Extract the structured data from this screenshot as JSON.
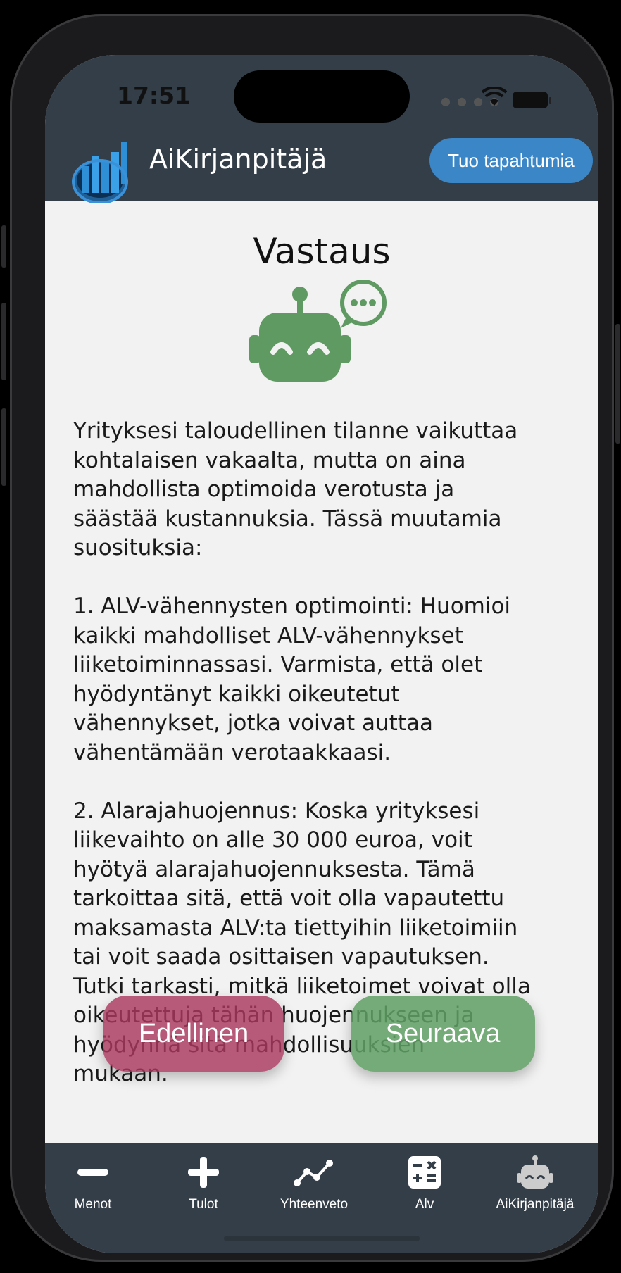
{
  "status_bar": {
    "time": "17:51"
  },
  "header": {
    "app_title": "AiKirjanpitäjä",
    "import_button": "Tuo tapahtumia"
  },
  "main": {
    "heading": "Vastaus",
    "answer_text": "Yrityksesi taloudellinen tilanne vaikuttaa\nkohtalaisen vakaalta, mutta on aina\nmahdollista optimoida verotusta ja\nsäästää kustannuksia. Tässä muutamia\nsuosituksia:\n\n1. ALV-vähennysten optimointi: Huomioi\nkaikki mahdolliset ALV-vähennykset\nliiketoiminnassasi. Varmista, että olet\nhyödyntänyt kaikki oikeutetut\nvähennykset, jotka voivat auttaa\nvähentämään verotaakkaasi.\n\n2. Alarajahuojennus: Koska yrityksesi\nliikevaihto on alle 30 000 euroa, voit\nhyötyä alarajahuojennuksesta. Tämä\ntarkoittaa sitä, että voit olla vapautettu\nmaksamasta ALV:ta tiettyihin liiketoimiin\ntai voit saada osittaisen vapautuksen.\nTutki tarkasti, mitkä liiketoimet voivat olla\noikeutettuja tähän huojennukseen ja\nhyödynnä sitä mahdollisuuksien\nmukaan.",
    "prev_button": "Edellinen",
    "next_button": "Seuraava"
  },
  "tabs": [
    {
      "label": "Menot",
      "icon": "minus-icon"
    },
    {
      "label": "Tulot",
      "icon": "plus-icon"
    },
    {
      "label": "Yhteenveto",
      "icon": "line-chart-icon"
    },
    {
      "label": "Alv",
      "icon": "calculator-icon"
    },
    {
      "label": "AiKirjanpitäjä",
      "icon": "robot-icon"
    }
  ],
  "colors": {
    "header_bg": "#343e48",
    "accent_blue": "#3b86c7",
    "bot_green": "#5f9a62",
    "prev_red": "#aa385f",
    "next_green": "#60a064"
  }
}
